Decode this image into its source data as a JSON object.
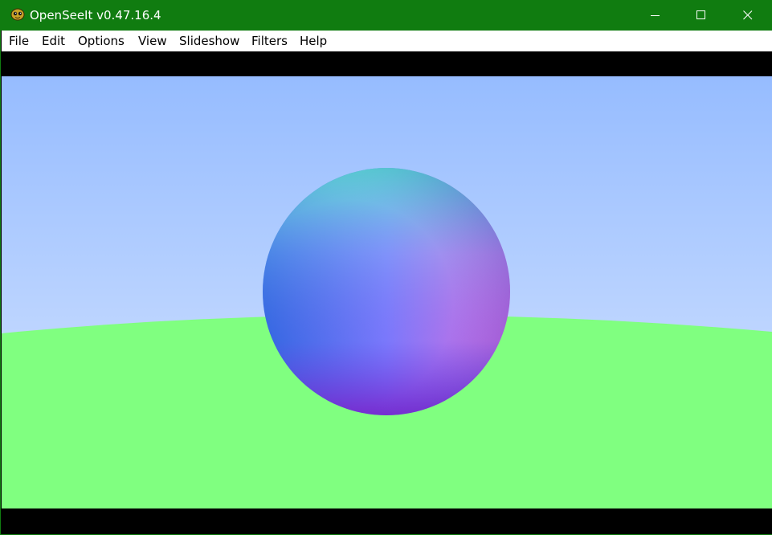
{
  "window": {
    "title": "OpenSeeIt v0.47.16.4",
    "icon": "openseeit-app-icon",
    "controls": {
      "minimize_icon": "minimize-icon",
      "maximize_icon": "maximize-icon",
      "close_icon": "close-icon"
    },
    "titlebar_color": "#107c10"
  },
  "menu": {
    "items": [
      "File",
      "Edit",
      "Options",
      "View",
      "Slideshow",
      "Filters",
      "Help"
    ]
  },
  "image": {
    "subject": "rendered sphere",
    "colors": {
      "sky_top": "#96bcff",
      "sky_bottom": "#d8e6ff",
      "ground": "#80ff80",
      "letterbox": "#000000"
    }
  }
}
